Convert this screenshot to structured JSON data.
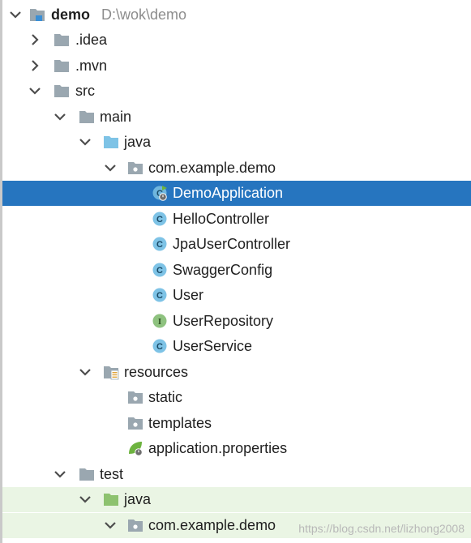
{
  "project": {
    "name": "demo",
    "path": "D:\\wok\\demo"
  },
  "nodes": {
    "idea": ".idea",
    "mvn": ".mvn",
    "src": "src",
    "main": "main",
    "main_java": "java",
    "main_package": "com.example.demo",
    "classes": [
      {
        "label": "DemoApplication",
        "kind": "class-runnable",
        "icon": "class-run-icon"
      },
      {
        "label": "HelloController",
        "kind": "class",
        "icon": "class-icon"
      },
      {
        "label": "JpaUserController",
        "kind": "class",
        "icon": "class-icon"
      },
      {
        "label": "SwaggerConfig",
        "kind": "class",
        "icon": "class-icon"
      },
      {
        "label": "User",
        "kind": "class",
        "icon": "class-icon"
      },
      {
        "label": "UserRepository",
        "kind": "interface",
        "icon": "interface-icon"
      },
      {
        "label": "UserService",
        "kind": "class",
        "icon": "class-icon"
      }
    ],
    "resources": "resources",
    "static": "static",
    "templates": "templates",
    "app_props": "application.properties",
    "test": "test",
    "test_java": "java",
    "test_package": "com.example.demo"
  },
  "selected": "DemoApplication",
  "watermark": "https://blog.csdn.net/lizhong2008",
  "colors": {
    "selection": "#2675bf",
    "test_highlight": "#eaf5e4",
    "folder_gray": "#9aa7b0",
    "source_folder_blue": "#7ec3e6",
    "test_folder_green": "#8dc26f",
    "class_badge": "#6fb6de",
    "interface_badge": "#8ec27f",
    "spring_green": "#6db33f"
  }
}
